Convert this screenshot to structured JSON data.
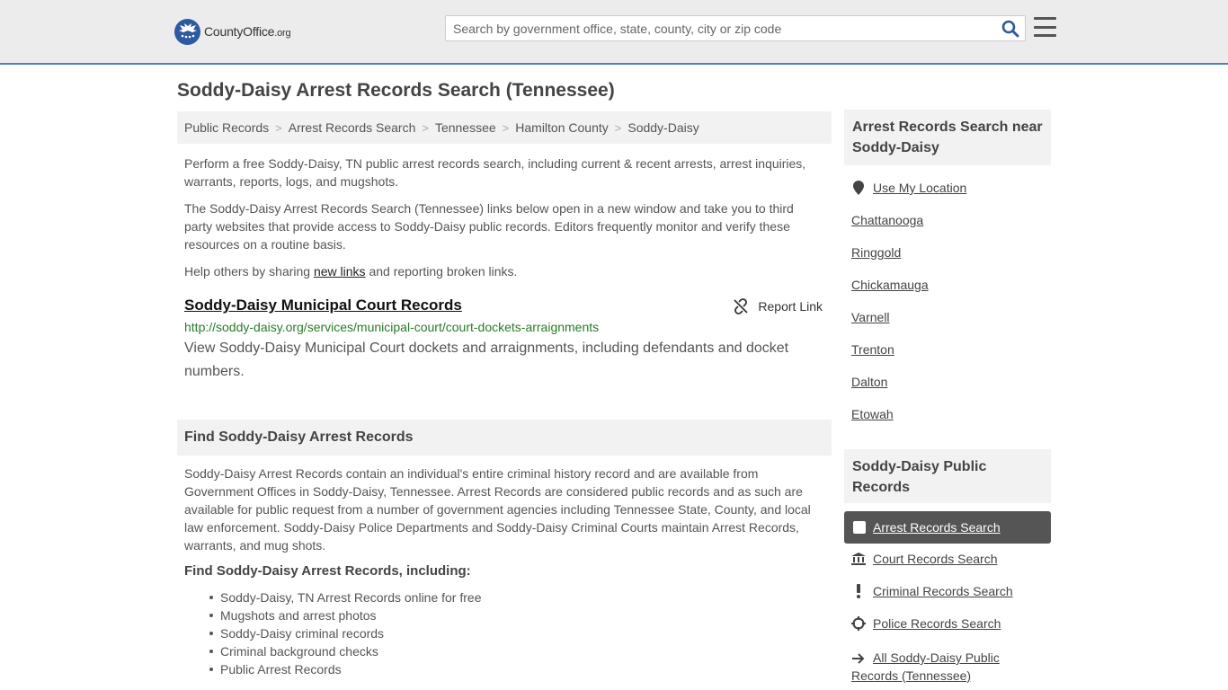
{
  "header": {
    "logo_name": "CountyOffice",
    "logo_tld": ".org",
    "search_placeholder": "Search by government office, state, county, city or zip code"
  },
  "page_title": "Soddy-Daisy Arrest Records Search (Tennessee)",
  "breadcrumb": [
    "Public Records",
    "Arrest Records Search",
    "Tennessee",
    "Hamilton County",
    "Soddy-Daisy"
  ],
  "intro": {
    "p1": "Perform a free Soddy-Daisy, TN public arrest records search, including current & recent arrests, arrest inquiries, warrants, reports, logs, and mugshots.",
    "p2": "The Soddy-Daisy Arrest Records Search (Tennessee) links below open in a new window and take you to third party websites that provide access to Soddy-Daisy public records. Editors frequently monitor and verify these resources on a routine basis.",
    "p3_before": "Help others by sharing ",
    "p3_link": "new links",
    "p3_after": " and reporting broken links."
  },
  "link_entry": {
    "title": "Soddy-Daisy Municipal Court Records",
    "report_label": "Report Link",
    "url": "http://soddy-daisy.org/services/municipal-court/court-dockets-arraignments",
    "description": "View Soddy-Daisy Municipal Court dockets and arraignments, including defendants and docket numbers."
  },
  "find_section": {
    "heading": "Find Soddy-Daisy Arrest Records",
    "body": "Soddy-Daisy Arrest Records contain an individual's entire criminal history record and are available from Government Offices in Soddy-Daisy, Tennessee. Arrest Records are considered public records and as such are available for public request from a number of government agencies including Tennessee State, County, and local law enforcement. Soddy-Daisy Police Departments and Soddy-Daisy Criminal Courts maintain Arrest Records, warrants, and mug shots.",
    "subheading": "Find Soddy-Daisy Arrest Records, including:",
    "bullets": [
      "Soddy-Daisy, TN Arrest Records online for free",
      "Mugshots and arrest photos",
      "Soddy-Daisy criminal records",
      "Criminal background checks",
      "Public Arrest Records"
    ]
  },
  "sidebar": {
    "near_heading": "Arrest Records Search near Soddy-Daisy",
    "use_location": "Use My Location",
    "nearby": [
      "Chattanooga",
      "Ringgold",
      "Chickamauga",
      "Varnell",
      "Trenton",
      "Dalton",
      "Etowah"
    ],
    "public_heading": "Soddy-Daisy Public Records",
    "active_item": "Arrest Records Search",
    "records_links": [
      "Court Records Search",
      "Criminal Records Search",
      "Police Records Search"
    ],
    "all_link": "All Soddy-Daisy Public Records (Tennessee)"
  },
  "colors": {
    "accent_border": "#4a80c8",
    "logo_blue": "#2d5aa0",
    "url_green": "#2a7a2a",
    "active_bg": "#555555"
  }
}
